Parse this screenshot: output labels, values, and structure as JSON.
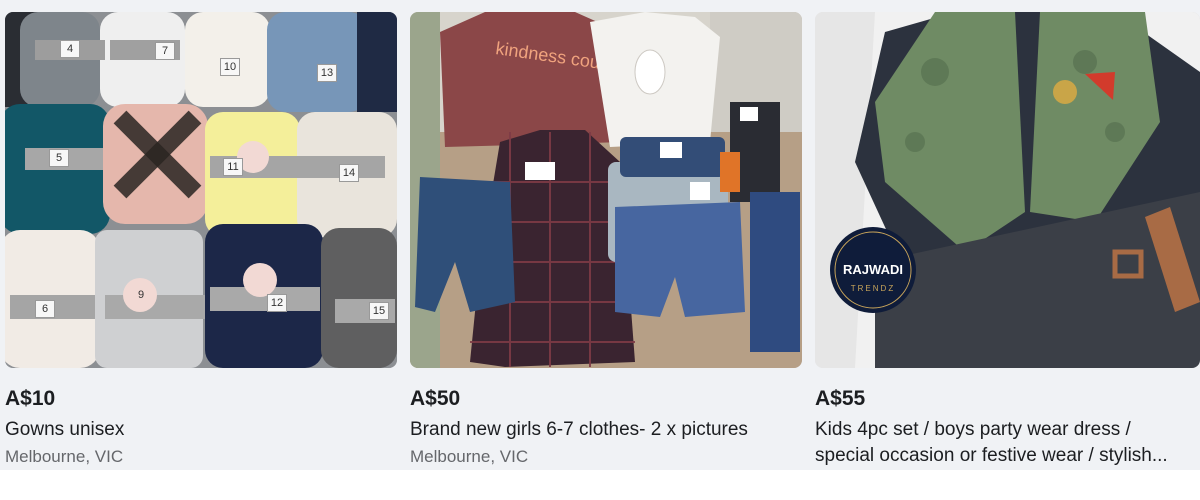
{
  "listings": [
    {
      "price": "A$10",
      "title": "Gowns unisex",
      "location": "Melbourne, VIC",
      "photo_tags": [
        "4",
        "7",
        "10",
        "13",
        "5",
        "11",
        "14",
        "9",
        "12",
        "6",
        "15"
      ]
    },
    {
      "price": "A$50",
      "title": "Brand new girls 6-7 clothes- 2 x pictures",
      "location": "Melbourne, VIC",
      "photo_text": "kindness counts"
    },
    {
      "price": "A$55",
      "title": "Kids 4pc set / boys party wear dress / special occasion or festive wear / stylish...",
      "location": "",
      "brand_badge": {
        "name": "RAJWADI",
        "sub": "TRENDZ"
      }
    }
  ]
}
